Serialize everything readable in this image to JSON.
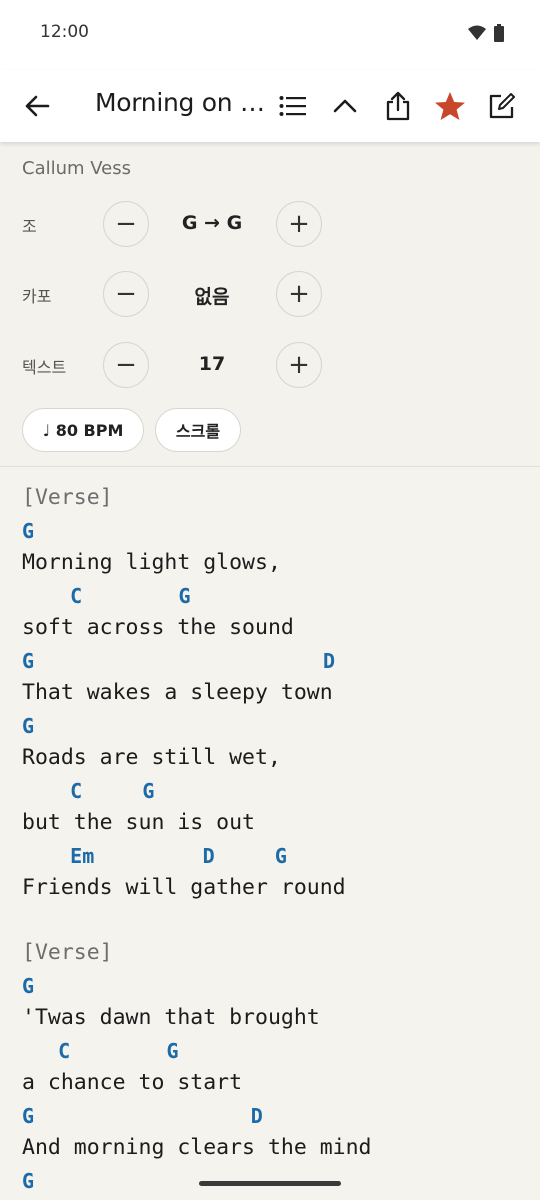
{
  "status": {
    "time": "12:00"
  },
  "app_bar": {
    "title": "Morning on the Quiet Hill"
  },
  "controls": {
    "artist": "Callum Vess",
    "key": {
      "label": "조",
      "value": "G → G"
    },
    "capo": {
      "label": "카포",
      "value": "없음"
    },
    "text_size": {
      "label": "텍스트",
      "value": "17"
    },
    "bpm_label": "♩ 80 BPM",
    "scroll_label": "스크롤"
  },
  "colors": {
    "chord": "#1d6aa8",
    "favorite": "#c8462a",
    "background": "#f5f3ee"
  },
  "sheet": [
    {
      "type": "section",
      "text": "[Verse]"
    },
    {
      "type": "chord",
      "text": "G"
    },
    {
      "type": "lyric",
      "text": "Morning light glows,"
    },
    {
      "type": "chord",
      "text": "    C        G"
    },
    {
      "type": "lyric",
      "text": "soft across the sound"
    },
    {
      "type": "chord",
      "text": "G                        D"
    },
    {
      "type": "lyric",
      "text": "That wakes a sleepy town"
    },
    {
      "type": "chord",
      "text": "G"
    },
    {
      "type": "lyric",
      "text": "Roads are still wet,"
    },
    {
      "type": "chord",
      "text": "    C     G"
    },
    {
      "type": "lyric",
      "text": "but the sun is out"
    },
    {
      "type": "chord",
      "text": "    Em         D     G"
    },
    {
      "type": "lyric",
      "text": "Friends will gather round"
    },
    {
      "type": "blank",
      "text": ""
    },
    {
      "type": "section",
      "text": "[Verse]"
    },
    {
      "type": "chord",
      "text": "G"
    },
    {
      "type": "lyric",
      "text": "'Twas dawn that brought"
    },
    {
      "type": "chord",
      "text": "   C        G"
    },
    {
      "type": "lyric",
      "text": "a chance to start"
    },
    {
      "type": "chord",
      "text": "G                  D"
    },
    {
      "type": "lyric",
      "text": "And morning clears the mind"
    },
    {
      "type": "chord",
      "text": "G"
    }
  ]
}
